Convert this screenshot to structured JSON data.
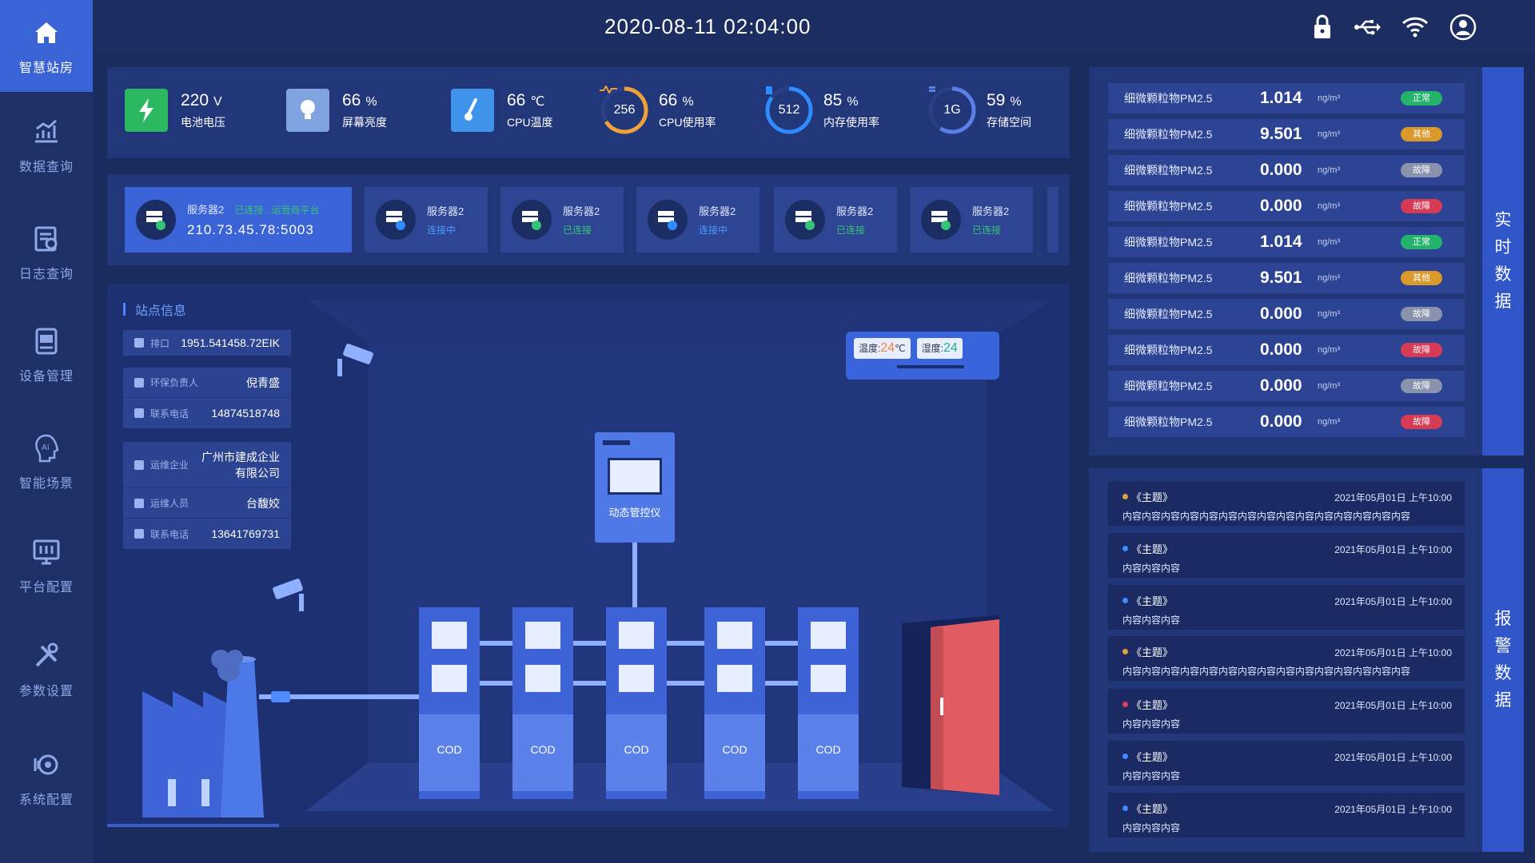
{
  "nav": [
    {
      "label": "智慧站房",
      "icon": "home-icon"
    },
    {
      "label": "数据查询",
      "icon": "chart-icon"
    },
    {
      "label": "日志查询",
      "icon": "log-icon"
    },
    {
      "label": "设备管理",
      "icon": "device-icon"
    },
    {
      "label": "智能场景",
      "icon": "ai-icon"
    },
    {
      "label": "平台配置",
      "icon": "platform-icon"
    },
    {
      "label": "参数设置",
      "icon": "tools-icon"
    },
    {
      "label": "系统配置",
      "icon": "system-icon"
    }
  ],
  "header": {
    "datetime": "2020-08-11   02:04:00"
  },
  "stats": {
    "voltage": {
      "value": "220",
      "unit": "V",
      "label": "电池电压"
    },
    "brightness": {
      "value": "66",
      "unit": "%",
      "label": "屏幕亮度"
    },
    "cpu_temp": {
      "value": "66",
      "unit": "℃",
      "label": "CPU温度"
    },
    "cpu_usage": {
      "ring": "256",
      "value": "66",
      "unit": "%",
      "label": "CPU使用率",
      "fraction": 0.66
    },
    "mem_usage": {
      "ring": "512",
      "value": "85",
      "unit": "%",
      "label": "内存使用率",
      "fraction": 0.85
    },
    "storage": {
      "ring": "1G",
      "value": "59",
      "unit": "%",
      "label": "存储空间",
      "fraction": 0.59
    }
  },
  "servers": [
    {
      "name": "服务器2",
      "status": "已连接...运营商平台",
      "addr": "210.73.45.78:5003"
    },
    {
      "name": "服务器2",
      "status": "连接中"
    },
    {
      "name": "服务器2",
      "status": "已连接"
    },
    {
      "name": "服务器2",
      "status": "连接中"
    },
    {
      "name": "服务器2",
      "status": "已连接"
    },
    {
      "name": "服务器2",
      "status": "已连接"
    }
  ],
  "site": {
    "title": "站点信息",
    "outlet": {
      "key": "排口",
      "value": "1951.541458.72EIK"
    },
    "env_owner": {
      "key": "环保负责人",
      "value": "倪青盛"
    },
    "env_phone": {
      "key": "联系电话",
      "value": "14874518748"
    },
    "ops_company": {
      "key": "运维企业",
      "value": "广州市建成企业有限公司"
    },
    "ops_person": {
      "key": "运维人员",
      "value": "台馥姣"
    },
    "ops_phone": {
      "key": "联系电话",
      "value": "13641769731"
    }
  },
  "scene": {
    "temp_label": "温度:",
    "temp_value": "24",
    "temp_unit": "℃",
    "humidity_label": "湿度:",
    "humidity_value": "24",
    "controller": "动态管控仪",
    "analyzers": [
      "COD",
      "COD",
      "COD",
      "COD",
      "COD"
    ]
  },
  "realtime": {
    "tab": [
      "实",
      "时",
      "数",
      "据"
    ],
    "rows": [
      {
        "name": "细微颗粒物PM2.5",
        "value": "1.014",
        "unit": "ng/m³",
        "status": "正常",
        "color": "#24b36b"
      },
      {
        "name": "细微颗粒物PM2.5",
        "value": "9.501",
        "unit": "ng/m³",
        "status": "其他",
        "color": "#d99a2b"
      },
      {
        "name": "细微颗粒物PM2.5",
        "value": "0.000",
        "unit": "ng/m³",
        "status": "故障",
        "color": "#8a93ad"
      },
      {
        "name": "细微颗粒物PM2.5",
        "value": "0.000",
        "unit": "ng/m³",
        "status": "故障",
        "color": "#d63a55"
      },
      {
        "name": "细微颗粒物PM2.5",
        "value": "1.014",
        "unit": "ng/m³",
        "status": "正常",
        "color": "#24b36b"
      },
      {
        "name": "细微颗粒物PM2.5",
        "value": "9.501",
        "unit": "ng/m³",
        "status": "其他",
        "color": "#d99a2b"
      },
      {
        "name": "细微颗粒物PM2.5",
        "value": "0.000",
        "unit": "ng/m³",
        "status": "故障",
        "color": "#8a93ad"
      },
      {
        "name": "细微颗粒物PM2.5",
        "value": "0.000",
        "unit": "ng/m³",
        "status": "故障",
        "color": "#d63a55"
      },
      {
        "name": "细微颗粒物PM2.5",
        "value": "0.000",
        "unit": "ng/m³",
        "status": "故障",
        "color": "#8a93ad"
      },
      {
        "name": "细微颗粒物PM2.5",
        "value": "0.000",
        "unit": "ng/m³",
        "status": "故障",
        "color": "#d63a55"
      }
    ]
  },
  "alarms": {
    "tab": [
      "报",
      "警",
      "数",
      "据"
    ],
    "rows": [
      {
        "topic": "《主题》",
        "date": "2021年05月01日  上午10:00",
        "content": "内容内容内容内容内容内容内容内容内容内容内容内容内容内容内容",
        "color": "#e0a33a"
      },
      {
        "topic": "《主题》",
        "date": "2021年05月01日  上午10:00",
        "content": "内容内容内容",
        "color": "#3d8bff"
      },
      {
        "topic": "《主题》",
        "date": "2021年05月01日  上午10:00",
        "content": "内容内容内容",
        "color": "#3d8bff"
      },
      {
        "topic": "《主题》",
        "date": "2021年05月01日  上午10:00",
        "content": "内容内容内容内容内容内容内容内容内容内容内容内容内容内容内容",
        "color": "#e0a33a"
      },
      {
        "topic": "《主题》",
        "date": "2021年05月01日  上午10:00",
        "content": "内容内容内容",
        "color": "#e0405a"
      },
      {
        "topic": "《主题》",
        "date": "2021年05月01日  上午10:00",
        "content": "内容内容内容",
        "color": "#3d8bff"
      },
      {
        "topic": "《主题》",
        "date": "2021年05月01日  上午10:00",
        "content": "内容内容内容",
        "color": "#3d8bff"
      }
    ]
  }
}
